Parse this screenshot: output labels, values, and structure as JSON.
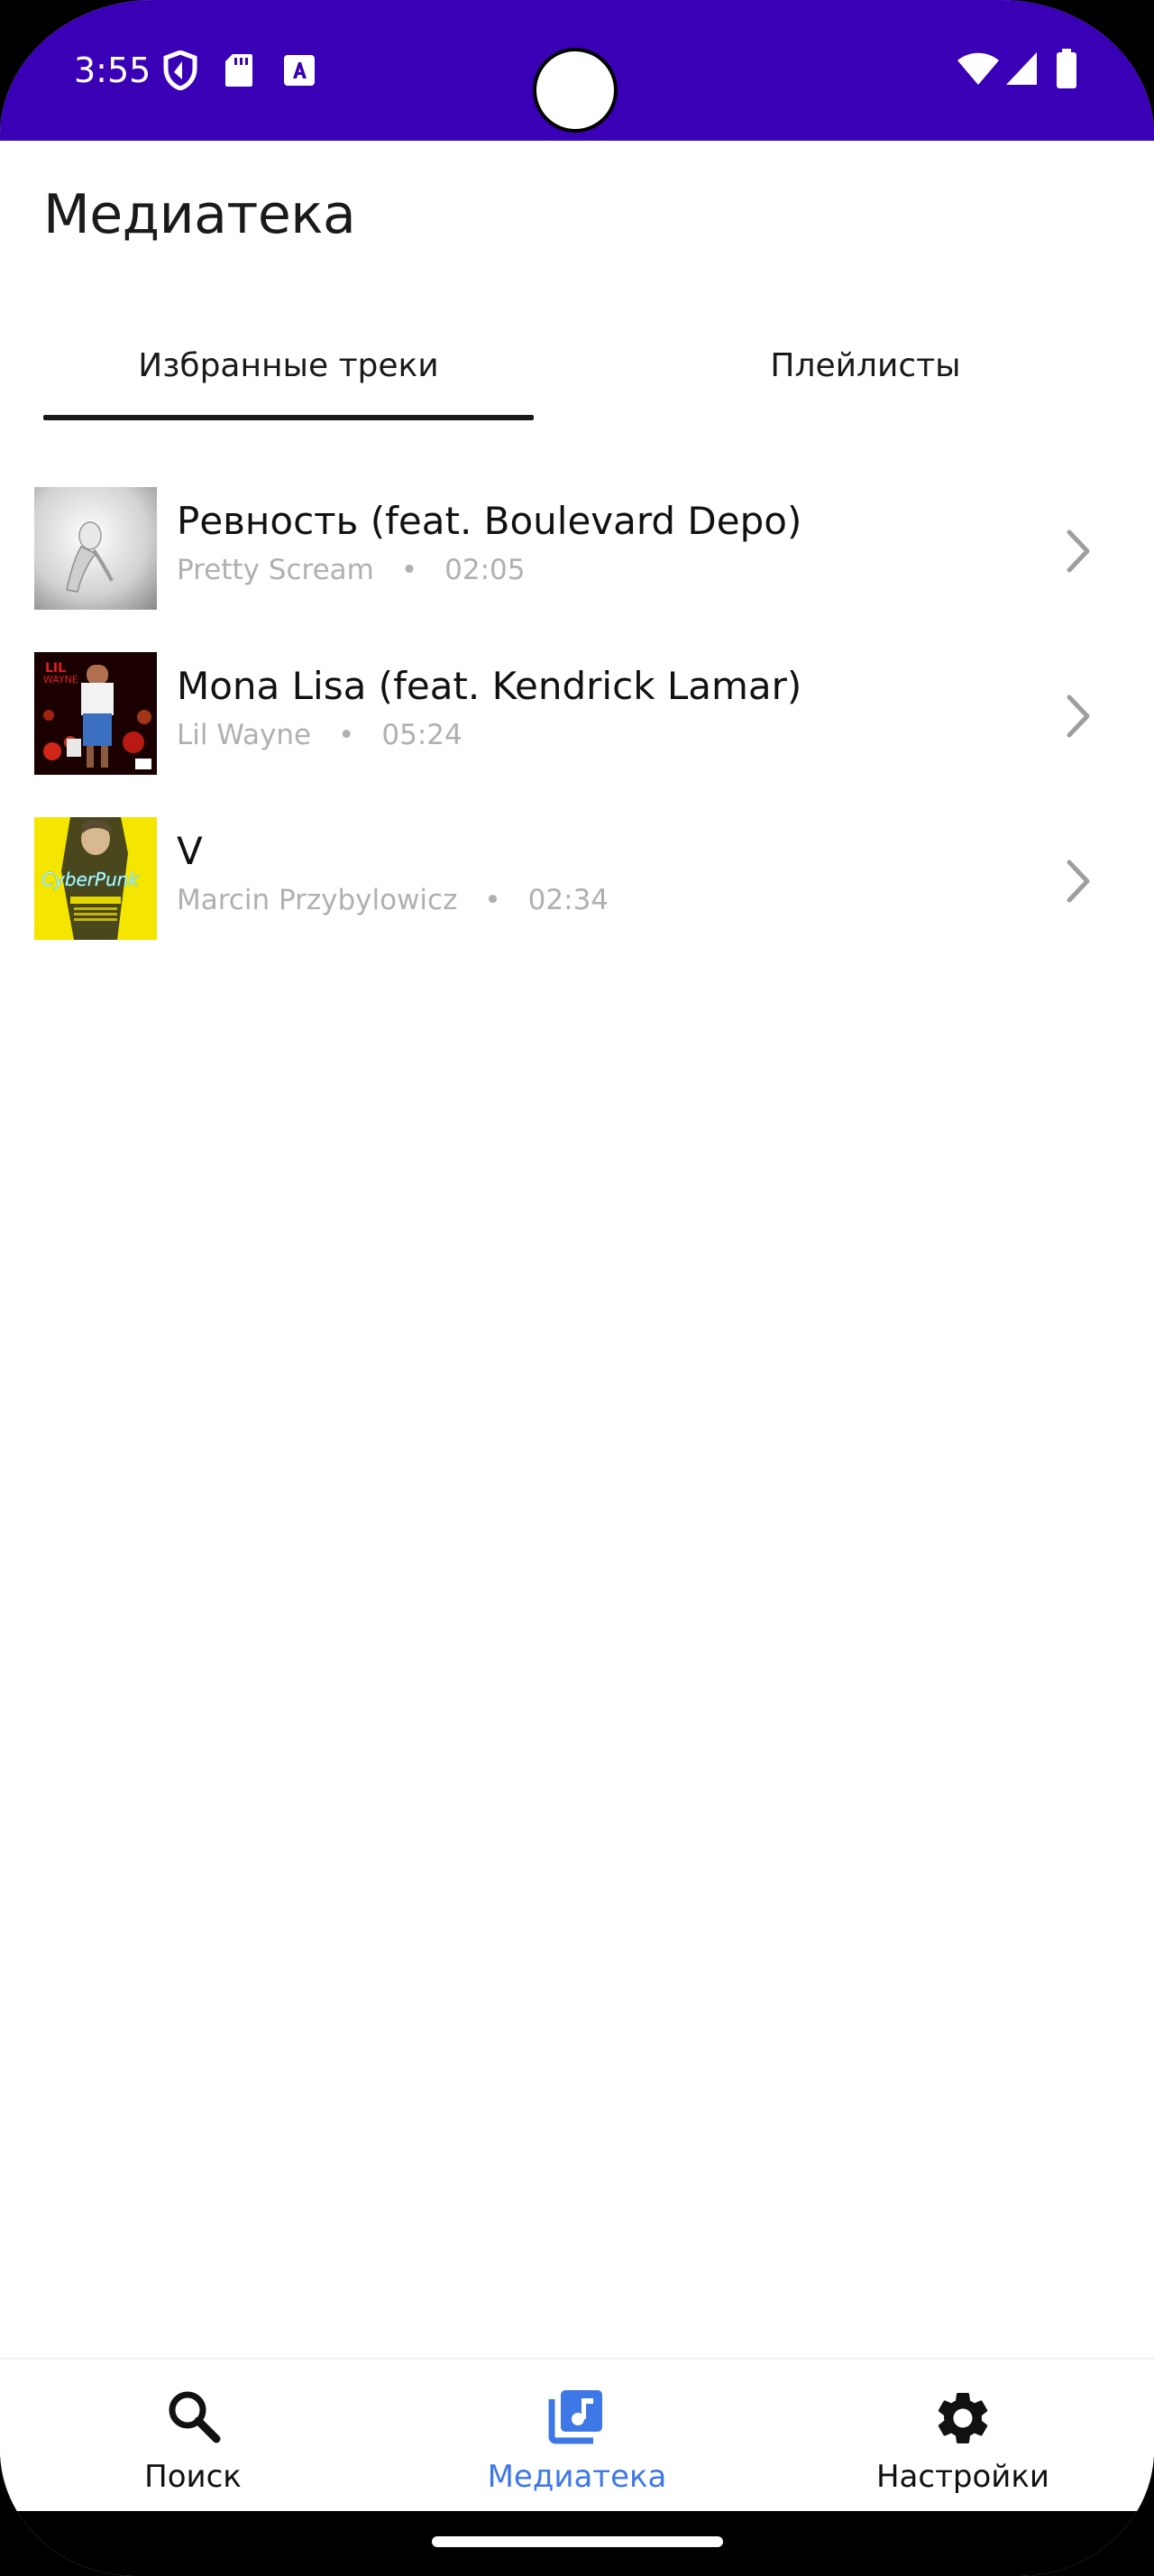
{
  "status_bar": {
    "time": "3:55",
    "background": "#3a00b5",
    "icons_left": [
      "shield-icon",
      "sd-card-icon",
      "font-a-icon"
    ],
    "icons_right": [
      "wifi-icon",
      "cell-signal-icon",
      "battery-icon"
    ]
  },
  "header": {
    "title": "Медиатека"
  },
  "tabs": [
    {
      "label": "Избранные треки",
      "active": true
    },
    {
      "label": "Плейлисты",
      "active": false
    }
  ],
  "tracks": [
    {
      "title": "Ревность (feat. Boulevard Depo)",
      "artist": "Pretty Scream",
      "duration": "02:05",
      "cover": "grey-figure-cover"
    },
    {
      "title": "Mona Lisa (feat. Kendrick Lamar)",
      "artist": "Lil Wayne",
      "duration": "05:24",
      "cover": "lil-wayne-tha-carter-v-cover"
    },
    {
      "title": "V",
      "artist": "Marcin Przybylowicz",
      "duration": "02:34",
      "cover": "cyberpunk-yellow-cover"
    }
  ],
  "bottom_nav": [
    {
      "label": "Поиск",
      "icon": "search-icon",
      "active": false
    },
    {
      "label": "Медиатека",
      "icon": "music-library-icon",
      "active": true
    },
    {
      "label": "Настройки",
      "icon": "gear-icon",
      "active": false
    }
  ],
  "colors": {
    "accent": "#3e78e6",
    "primary_text": "#111111",
    "secondary_text": "#b0b0b0",
    "chevron": "#9e9e9e"
  }
}
